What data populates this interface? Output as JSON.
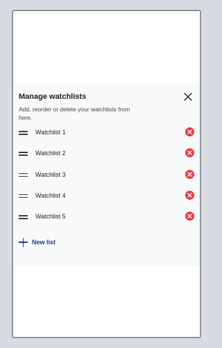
{
  "header": {
    "title": "Manage watchlists",
    "subtitle": "Add, reorder or delete your watchlists from here."
  },
  "watchlists": [
    {
      "label": "Watchlist 1"
    },
    {
      "label": "Watchlist 2"
    },
    {
      "label": "Watchlist 3"
    },
    {
      "label": "Watchlist 4"
    },
    {
      "label": "Watchlist 5"
    }
  ],
  "actions": {
    "new_list_label": "New list"
  },
  "colors": {
    "accent": "#1e3a8a",
    "delete": "#ea3c46"
  },
  "icons": {
    "close": "close-icon",
    "drag": "drag-handle-icon",
    "delete": "delete-icon",
    "add": "plus-icon"
  }
}
